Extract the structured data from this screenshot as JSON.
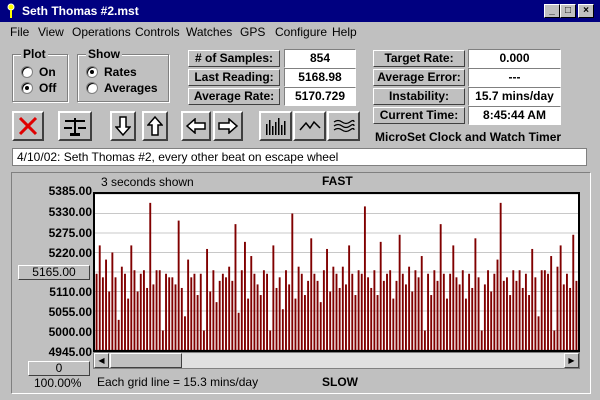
{
  "window": {
    "title": "Seth Thomas #2.mst",
    "min": "_",
    "max": "□",
    "close": "×"
  },
  "menu": [
    "File",
    "View",
    "Operations",
    "Controls",
    "Watches",
    "GPS",
    "Configure",
    "Help"
  ],
  "plot": {
    "legend": "Plot",
    "on": "On",
    "off": "Off",
    "selected": "Off"
  },
  "show": {
    "legend": "Show",
    "rates": "Rates",
    "averages": "Averages",
    "selected": "Rates"
  },
  "stats_left": [
    {
      "label": "# of Samples:",
      "value": "854"
    },
    {
      "label": "Last Reading:",
      "value": "5168.98"
    },
    {
      "label": "Average Rate:",
      "value": "5170.729"
    }
  ],
  "stats_right": [
    {
      "label": "Target Rate:",
      "value": "0.000"
    },
    {
      "label": "Average Error:",
      "value": "---"
    },
    {
      "label": "Instability:",
      "value": "15.7 mins/day"
    },
    {
      "label": "Current Time:",
      "value": "8:45:44 AM"
    }
  ],
  "brand": "MicroSet Clock and Watch Timer",
  "notes": "4/10/02: Seth Thomas #2, every other beat on escape wheel",
  "chart_panel": {
    "shown_label": "3 seconds shown",
    "fast_label": "FAST",
    "slow_label": "SLOW",
    "grid_label": "Each grid line = 15.3 mins/day",
    "center_button": "5165.00",
    "zero_button": "0",
    "zoom": "100.00%",
    "bar_color": "#800000"
  },
  "chart_data": {
    "type": "bar",
    "title": "",
    "xlabel": "",
    "ylabel": "",
    "ytick_labels": [
      "5385.00",
      "5330.00",
      "5275.00",
      "5220.00",
      "5165.00",
      "5110.00",
      "5055.00",
      "5000.00",
      "4945.00"
    ],
    "ylim": [
      4945,
      5385
    ],
    "grid": true,
    "values": [
      5160,
      5240,
      5150,
      5200,
      5110,
      5220,
      5150,
      5030,
      5180,
      5160,
      5090,
      5240,
      5170,
      5110,
      5160,
      5170,
      5120,
      5360,
      5130,
      5170,
      5170,
      5000,
      5160,
      5150,
      5150,
      5130,
      5310,
      5120,
      5040,
      5200,
      5150,
      5160,
      5100,
      5160,
      5000,
      5230,
      5110,
      5170,
      5080,
      5140,
      5160,
      5150,
      5180,
      5140,
      5300,
      5050,
      5170,
      5250,
      5090,
      5210,
      5160,
      5130,
      5100,
      5170,
      5160,
      5000,
      5240,
      5120,
      5150,
      5060,
      5170,
      5130,
      5330,
      5090,
      5180,
      5160,
      5100,
      5140,
      5260,
      5160,
      5140,
      5080,
      5170,
      5230,
      5110,
      5180,
      5160,
      5120,
      5180,
      5130,
      5240,
      5160,
      5100,
      5170,
      5160,
      5350,
      5150,
      5120,
      5170,
      5100,
      5250,
      5140,
      5160,
      5170,
      5090,
      5140,
      5270,
      5160,
      5130,
      5180,
      5110,
      5170,
      5150,
      5210,
      5000,
      5160,
      5100,
      5170,
      5140,
      5300,
      5160,
      5090,
      5160,
      5240,
      5150,
      5130,
      5170,
      5090,
      5160,
      5120,
      5260,
      5150,
      5000,
      5130,
      5170,
      5110,
      5160,
      5200,
      5360,
      5140,
      5150,
      5100,
      5170,
      5140,
      5170,
      5120,
      5160,
      5100,
      5230,
      5150,
      5040,
      5170,
      5170,
      5160,
      5210,
      5000,
      5180,
      5240,
      5130,
      5160,
      5120,
      5270,
      5140
    ]
  }
}
